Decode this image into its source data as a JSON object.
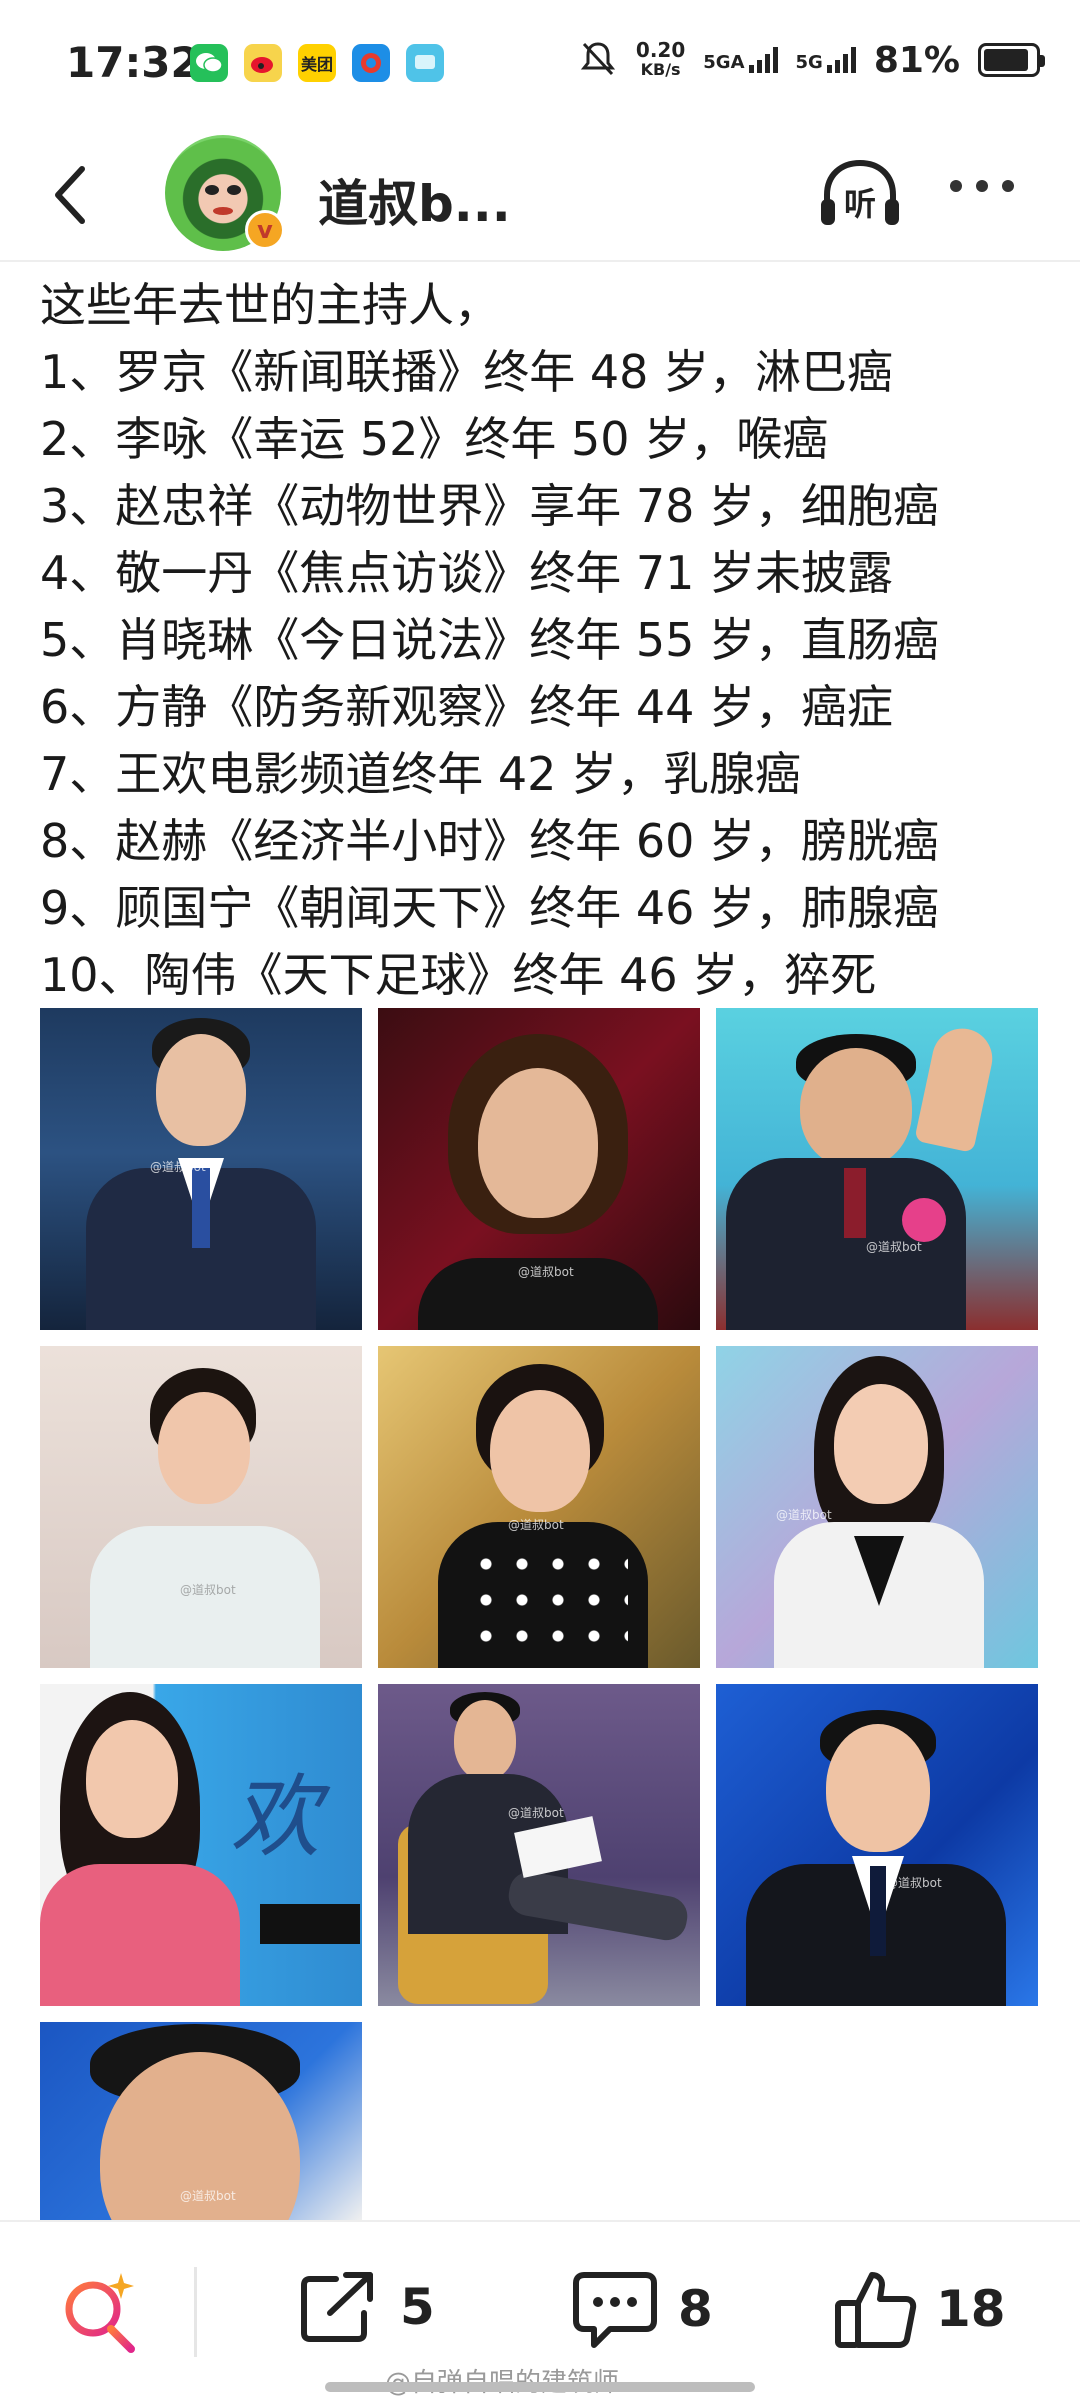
{
  "status_bar": {
    "time": "17:32",
    "app_icons": [
      "wechat-icon",
      "weibo-icon",
      "meituan-icon",
      "app-icon",
      "message-icon"
    ],
    "meituan_label": "美团",
    "net_speed_value": "0.20",
    "net_speed_unit": "KB/s",
    "sim1": "5GA",
    "sim2": "5G",
    "battery": "81%",
    "battery_level": 0.81
  },
  "header": {
    "username": "道叔b...",
    "verified_mark": "v",
    "listen_label": "听"
  },
  "post": {
    "lines": [
      "这些年去世的主持人，",
      "1、罗京《新闻联播》终年 48 岁，淋巴癌",
      "2、李咏《幸运 52》终年 50 岁，喉癌",
      "3、赵忠祥《动物世界》享年 78 岁，细胞癌",
      "4、敬一丹《焦点访谈》终年 71 岁未披露",
      "5、肖晓琳《今日说法》终年 55 岁，直肠癌",
      "6、方静《防务新观察》终年 44 岁，癌症",
      "7、王欢电影频道终年 42 岁，乳腺癌",
      "8、赵赫《经济半小时》终年 60 岁，膀胱癌",
      "9、顾国宁《朝闻天下》终年 46 岁，肺腺癌",
      "10、陶伟《天下足球》终年 46 岁，猝死"
    ]
  },
  "photos": {
    "count": 10,
    "watermark": "@道叔bot",
    "photo7_text": "欢"
  },
  "bottom_bar": {
    "share_count": "5",
    "comment_count": "8",
    "like_count": "18",
    "watermark": "@自弹自唱的建筑师"
  }
}
